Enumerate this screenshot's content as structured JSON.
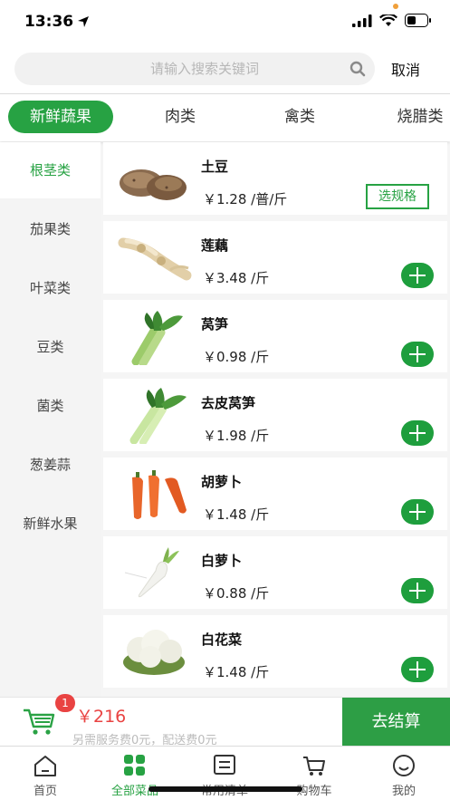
{
  "status": {
    "time": "13:36"
  },
  "search": {
    "placeholder": "请输入搜索关键词",
    "cancel_label": "取消"
  },
  "category_tabs": [
    {
      "label": "新鲜蔬果",
      "active": true
    },
    {
      "label": "肉类"
    },
    {
      "label": "禽类"
    },
    {
      "label": "烧腊类"
    }
  ],
  "sidebar": {
    "items": [
      {
        "label": "根茎类",
        "active": true
      },
      {
        "label": "茄果类"
      },
      {
        "label": "叶菜类"
      },
      {
        "label": "豆类"
      },
      {
        "label": "菌类"
      },
      {
        "label": "葱姜蒜"
      },
      {
        "label": "新鲜水果"
      }
    ]
  },
  "products": [
    {
      "name": "土豆",
      "price": "￥1.28 /普/斤",
      "action": "选规格",
      "image": "potato"
    },
    {
      "name": "莲藕",
      "price": "￥3.48 /斤",
      "image": "lotus-root"
    },
    {
      "name": "莴笋",
      "price": "￥0.98 /斤",
      "image": "celtuce"
    },
    {
      "name": "去皮莴笋",
      "price": "￥1.98 /斤",
      "image": "peeled-celtuce"
    },
    {
      "name": "胡萝卜",
      "price": "￥1.48 /斤",
      "image": "carrot"
    },
    {
      "name": "白萝卜",
      "price": "￥0.88 /斤",
      "image": "white-radish"
    },
    {
      "name": "白花菜",
      "price": "￥1.48 /斤",
      "image": "cauliflower"
    }
  ],
  "cart": {
    "badge": "1",
    "total": "￥216",
    "note": "另需服务费0元，配送费0元",
    "checkout_label": "去结算"
  },
  "tabbar": [
    {
      "label": "首页",
      "icon": "home-icon"
    },
    {
      "label": "全部菜品",
      "icon": "grid-icon",
      "active": true
    },
    {
      "label": "常用清单",
      "icon": "list-icon"
    },
    {
      "label": "购物车",
      "icon": "cart-icon"
    },
    {
      "label": "我的",
      "icon": "profile-icon"
    }
  ],
  "colors": {
    "accent": "#27a243",
    "price_red": "#e94342"
  }
}
